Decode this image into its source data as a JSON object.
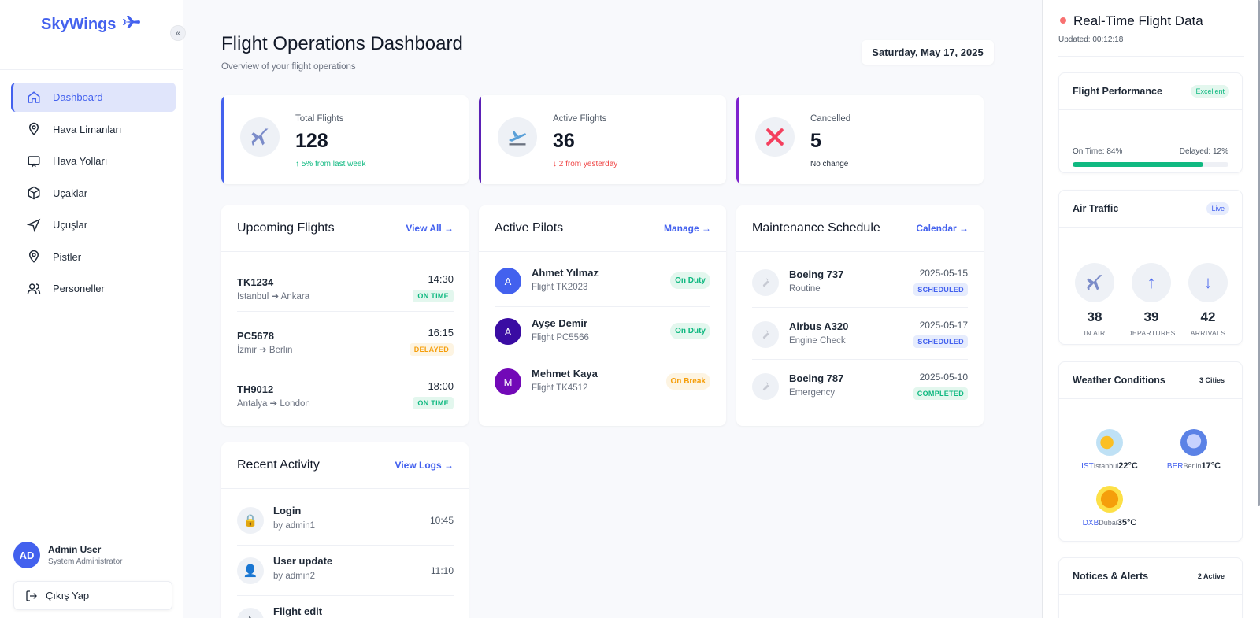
{
  "brand": {
    "name": "SkyWings"
  },
  "sidebar": {
    "collapse_icon": "«",
    "items": [
      {
        "label": "Dashboard",
        "icon": "home-icon"
      },
      {
        "label": "Hava Limanları",
        "icon": "location-pin-icon"
      },
      {
        "label": "Hava Yolları",
        "icon": "monitor-icon"
      },
      {
        "label": "Uçaklar",
        "icon": "box-icon"
      },
      {
        "label": "Uçuşlar",
        "icon": "send-icon"
      },
      {
        "label": "Pistler",
        "icon": "location-pin-icon"
      },
      {
        "label": "Personeller",
        "icon": "users-icon"
      }
    ],
    "user": {
      "initials": "AD",
      "name": "Admin User",
      "role": "System Administrator"
    },
    "logout_label": "Çıkış Yap"
  },
  "header": {
    "title": "Flight Operations Dashboard",
    "subtitle": "Overview of your flight operations",
    "date": "Saturday, May 17, 2025"
  },
  "stats": [
    {
      "label": "Total Flights",
      "value": "128",
      "change": "↑ 5% from last week",
      "color": "#4361ee"
    },
    {
      "label": "Active Flights",
      "value": "36",
      "change": "↓ 2 from yesterday",
      "color": "#5b21b6"
    },
    {
      "label": "Cancelled",
      "value": "5",
      "change": "No change",
      "color": "#7e22ce"
    }
  ],
  "upcoming": {
    "title": "Upcoming Flights",
    "link": "View All →",
    "flights": [
      {
        "code": "TK1234",
        "route": "Istanbul ➔ Ankara",
        "time": "14:30",
        "status": "ON TIME"
      },
      {
        "code": "PC5678",
        "route": "İzmir ➔ Berlin",
        "time": "16:15",
        "status": "DELAYED"
      },
      {
        "code": "TH9012",
        "route": "Antalya ➔ London",
        "time": "18:00",
        "status": "ON TIME"
      }
    ]
  },
  "pilots": {
    "title": "Active Pilots",
    "link": "Manage →",
    "list": [
      {
        "initial": "A",
        "name": "Ahmet Yılmaz",
        "flight": "Flight TK2023",
        "status": "On Duty",
        "color": "#4361ee"
      },
      {
        "initial": "A",
        "name": "Ayşe Demir",
        "flight": "Flight PC5566",
        "status": "On Duty",
        "color": "#3a0ca3"
      },
      {
        "initial": "M",
        "name": "Mehmet Kaya",
        "flight": "Flight TK4512",
        "status": "On Break",
        "color": "#7209b7"
      }
    ]
  },
  "maintenance": {
    "title": "Maintenance Schedule",
    "link": "Calendar →",
    "list": [
      {
        "aircraft": "Boeing 737",
        "type": "Routine",
        "date": "2025-05-15",
        "status": "SCHEDULED"
      },
      {
        "aircraft": "Airbus A320",
        "type": "Engine Check",
        "date": "2025-05-17",
        "status": "SCHEDULED"
      },
      {
        "aircraft": "Boeing 787",
        "type": "Emergency",
        "date": "2025-05-10",
        "status": "COMPLETED"
      }
    ]
  },
  "activity": {
    "title": "Recent Activity",
    "link": "View Logs →",
    "list": [
      {
        "icon": "🔒",
        "action": "Login",
        "by": "by admin1",
        "time": "10:45"
      },
      {
        "icon": "👤",
        "action": "User update",
        "by": "by admin2",
        "time": "11:10"
      },
      {
        "icon": "✈",
        "action": "Flight edit",
        "by": "",
        "time": ""
      }
    ]
  },
  "realtime": {
    "title": "Real-Time Flight Data",
    "updated": "Updated: 00:12:18",
    "performance": {
      "title": "Flight Performance",
      "badge": "Excellent",
      "on_time": "On Time: 84%",
      "delayed": "Delayed: 12%",
      "on_time_fraction": 0.84
    },
    "traffic": {
      "title": "Air Traffic",
      "badge": "Live",
      "items": [
        {
          "icon": "✈",
          "value": "38",
          "label": "IN AIR"
        },
        {
          "icon": "↑",
          "value": "39",
          "label": "DEPARTURES"
        },
        {
          "icon": "↓",
          "value": "42",
          "label": "ARRIVALS"
        }
      ]
    },
    "weather": {
      "title": "Weather Conditions",
      "badge": "3 Cities",
      "cities": [
        {
          "code": "IST",
          "name": "Istanbul",
          "temp": "22°C",
          "icon": "partly-cloudy-icon"
        },
        {
          "code": "BER",
          "name": "Berlin",
          "temp": "17°C",
          "icon": "rain-cloud-icon"
        },
        {
          "code": "DXB",
          "name": "Dubai",
          "temp": "35°C",
          "icon": "sun-icon"
        }
      ]
    },
    "notices": {
      "title": "Notices & Alerts",
      "badge": "2 Active"
    }
  }
}
